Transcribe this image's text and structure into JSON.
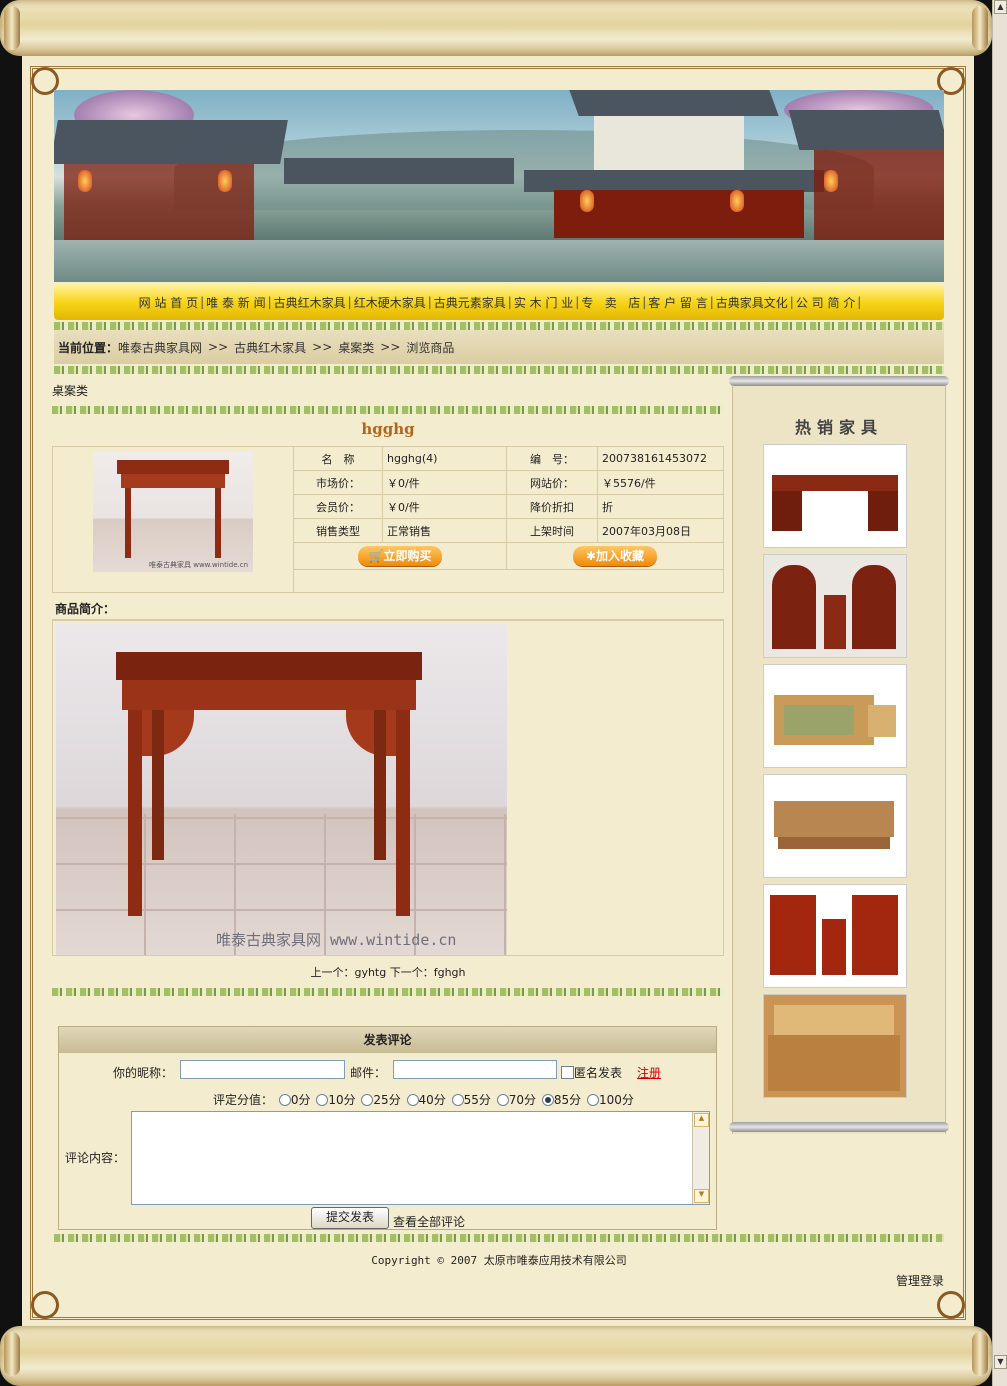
{
  "nav": {
    "items": [
      "网 站 首 页",
      "唯 泰 新 闻",
      "古典红木家具",
      "红木硬木家具",
      "古典元素家具",
      "实 木 门 业",
      "专   卖   店",
      "客 户 留 言",
      "古典家具文化",
      "公 司 简 介"
    ]
  },
  "breadcrumb": {
    "label": "当前位置：",
    "items": [
      "唯泰古典家具网",
      ">>",
      "古典红木家具",
      ">>",
      "桌案类",
      ">>",
      "浏览商品"
    ]
  },
  "category": "桌案类",
  "product": {
    "title": "hgghg",
    "name_label": "名　称",
    "name": "hgghg(4)",
    "code_label": "编　号：",
    "code": "200738161453072",
    "market_price_label": "市场价：",
    "market_price": "￥0/件",
    "site_price_label": "网站价：",
    "site_price": "￥5576/件",
    "member_price_label": "会员价：",
    "member_price": "￥0/件",
    "discount_label": "降价折扣",
    "discount": "折",
    "sale_type_label": "销售类型",
    "sale_type": "正常销售",
    "date_label": "上架时间",
    "date": "2007年03月08日",
    "buy_button": "立即购买",
    "fav_button": "加入收藏",
    "thumb_watermark": "唯泰古典家具 www.wintide.cn",
    "intro_label": "商品简介：",
    "image_watermark": "唯泰古典家具网 www.wintide.cn",
    "prev_label": "上一个：",
    "prev": "gyhtg",
    "next_label": "下一个：",
    "next": "fghgh"
  },
  "comment": {
    "title": "发表评论",
    "nickname_label": "你的昵称：",
    "email_label": "邮件：",
    "anonymous_label": "匿名发表",
    "register_link": "注册",
    "rating_label": "评定分值：",
    "ratings": [
      "0分",
      "10分",
      "25分",
      "40分",
      "55分",
      "70分",
      "85分",
      "100分"
    ],
    "selected_rating": "85分",
    "content_label": "评论内容：",
    "submit_button": "提交发表",
    "view_all": "查看全部评论"
  },
  "sidebar": {
    "title": "热销家具"
  },
  "footer": {
    "copyright": "Copyright © 2007 太原市唯泰应用技术有限公司",
    "admin_login": "管理登录"
  },
  "colors": {
    "nav_yellow": "#f7d51a",
    "title_orange": "#b1661d",
    "register_red": "#cc0000",
    "wood": "#8d2b13"
  }
}
